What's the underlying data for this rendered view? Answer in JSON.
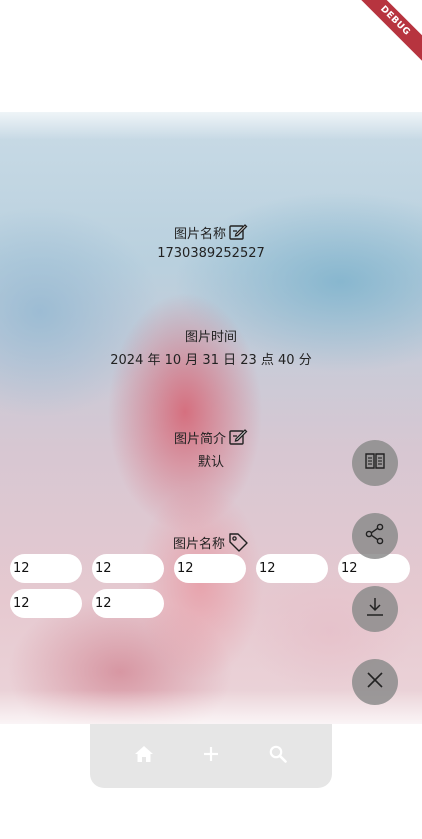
{
  "debug_banner": "DEBUG",
  "info": {
    "name_title": "图片名称",
    "name_value": "1730389252527",
    "time_title": "图片时间",
    "time_value": "2024 年 10 月 31 日 23 点 40 分",
    "desc_title": "图片简介",
    "desc_value": "默认",
    "tags_title": "图片名称"
  },
  "tags": [
    "12",
    "12",
    "12",
    "12",
    "12",
    "12",
    "12"
  ],
  "fabs": [
    "book-icon",
    "share-icon",
    "download-icon",
    "close-icon"
  ],
  "bottom_nav": [
    "home-icon",
    "add-icon",
    "search-icon"
  ],
  "colors": {
    "fab_bg": "#8c8c8c",
    "bottom_bar_bg": "#e6e6e6",
    "debug_banner": "#b7343f"
  }
}
